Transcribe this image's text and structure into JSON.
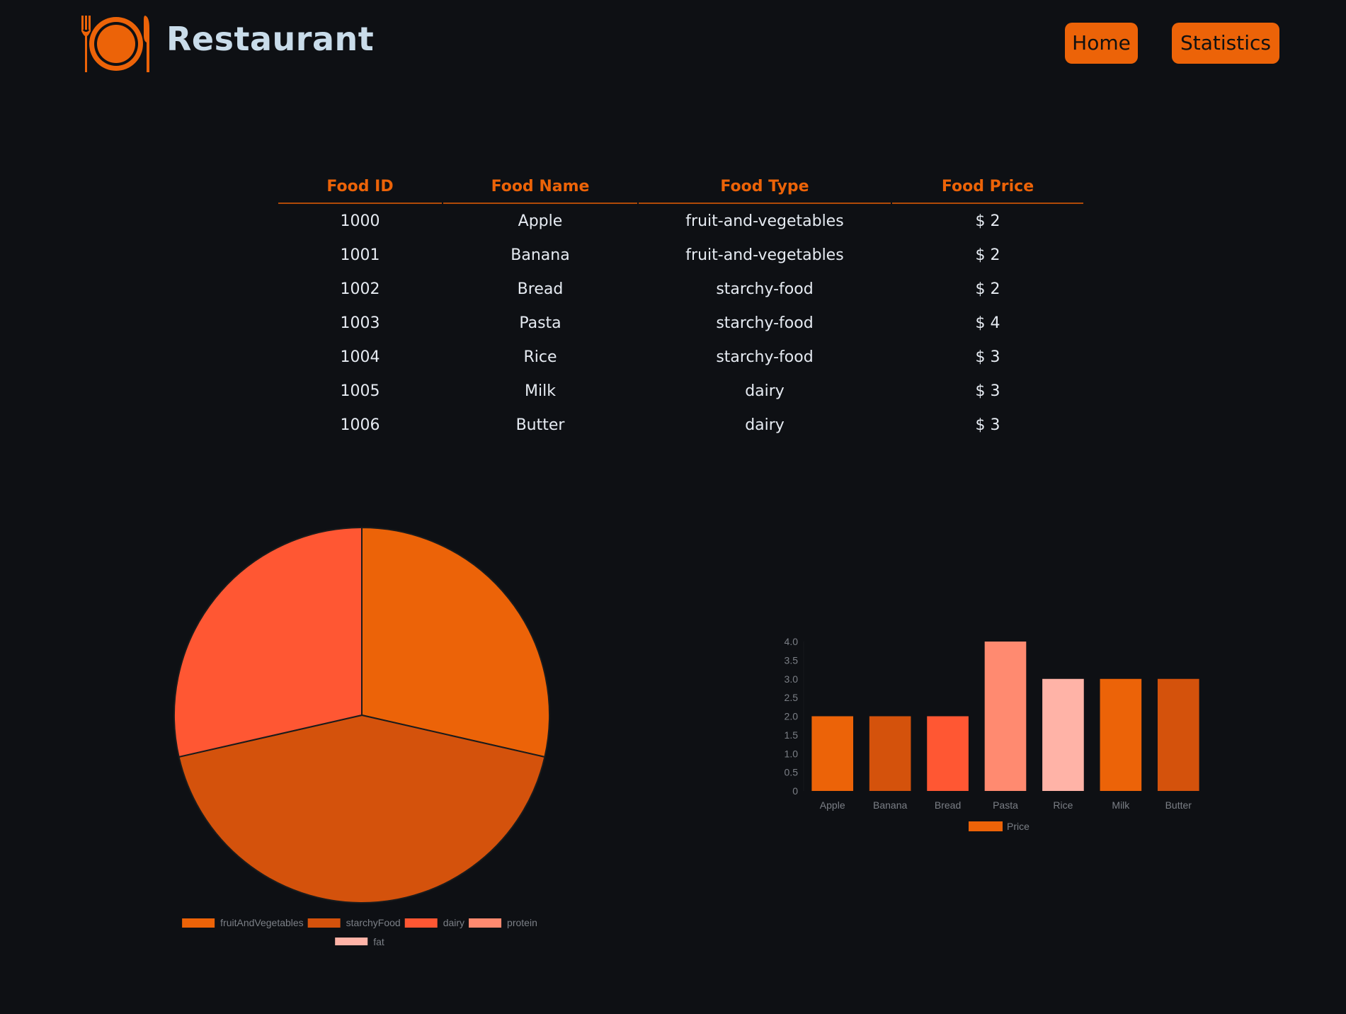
{
  "header": {
    "brand": "Restaurant",
    "nav": [
      {
        "label": "Home"
      },
      {
        "label": "Statistics"
      }
    ]
  },
  "colors": {
    "accent": "#ec6308",
    "background": "#0e1014",
    "text": "#e6ebf2",
    "brand_text": "#c9dcea"
  },
  "table": {
    "headers": [
      "Food ID",
      "Food Name",
      "Food Type",
      "Food Price"
    ],
    "rows": [
      [
        "1000",
        "Apple",
        "fruit-and-vegetables",
        "$ 2"
      ],
      [
        "1001",
        "Banana",
        "fruit-and-vegetables",
        "$ 2"
      ],
      [
        "1002",
        "Bread",
        "starchy-food",
        "$ 2"
      ],
      [
        "1003",
        "Pasta",
        "starchy-food",
        "$ 4"
      ],
      [
        "1004",
        "Rice",
        "starchy-food",
        "$ 3"
      ],
      [
        "1005",
        "Milk",
        "dairy",
        "$ 3"
      ],
      [
        "1006",
        "Butter",
        "dairy",
        "$ 3"
      ]
    ]
  },
  "chart_data": [
    {
      "type": "pie",
      "categories": [
        "fruitAndVegetables",
        "starchyFood",
        "dairy",
        "protein",
        "fat"
      ],
      "values": [
        2,
        3,
        2,
        0,
        0
      ],
      "colors": [
        "#ec6308",
        "#d4520c",
        "#ff5733",
        "#ff8a70",
        "#ffb3a7"
      ],
      "legend": "bottom"
    },
    {
      "type": "bar",
      "categories": [
        "Apple",
        "Banana",
        "Bread",
        "Pasta",
        "Rice",
        "Milk",
        "Butter"
      ],
      "series": [
        {
          "name": "Price",
          "values": [
            2,
            2,
            2,
            4,
            3,
            3,
            3
          ]
        }
      ],
      "colors": [
        "#ec6308",
        "#d4520c",
        "#ff5733",
        "#ff8a70",
        "#ffb3a7",
        "#ec6308",
        "#d4520c"
      ],
      "ylim": [
        0,
        4
      ],
      "yticks": [
        "0",
        "0.5",
        "1.0",
        "1.5",
        "2.0",
        "2.5",
        "3.0",
        "3.5",
        "4.0"
      ],
      "legend": "bottom"
    }
  ]
}
